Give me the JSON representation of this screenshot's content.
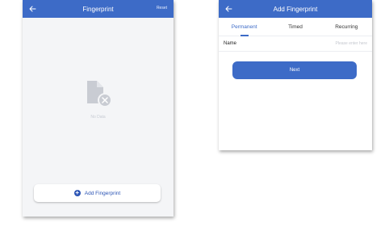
{
  "screen1": {
    "title": "Fingerprint",
    "right_action": "Reset",
    "empty_label": "No Data",
    "add_button_label": "Add Fingerprint"
  },
  "screen2": {
    "title": "Add Fingerprint",
    "tabs": [
      {
        "label": "Permanent",
        "active": true
      },
      {
        "label": "Timed",
        "active": false
      },
      {
        "label": "Recurring",
        "active": false
      }
    ],
    "name_label": "Name",
    "name_placeholder": "Please enter here",
    "next_label": "Next"
  },
  "colors": {
    "header": "#3d6bc7",
    "accent": "#2c55b5",
    "empty_icon": "#c9ccd3"
  },
  "icons": [
    "back-arrow-icon",
    "empty-file-icon",
    "plus-circle-icon"
  ]
}
